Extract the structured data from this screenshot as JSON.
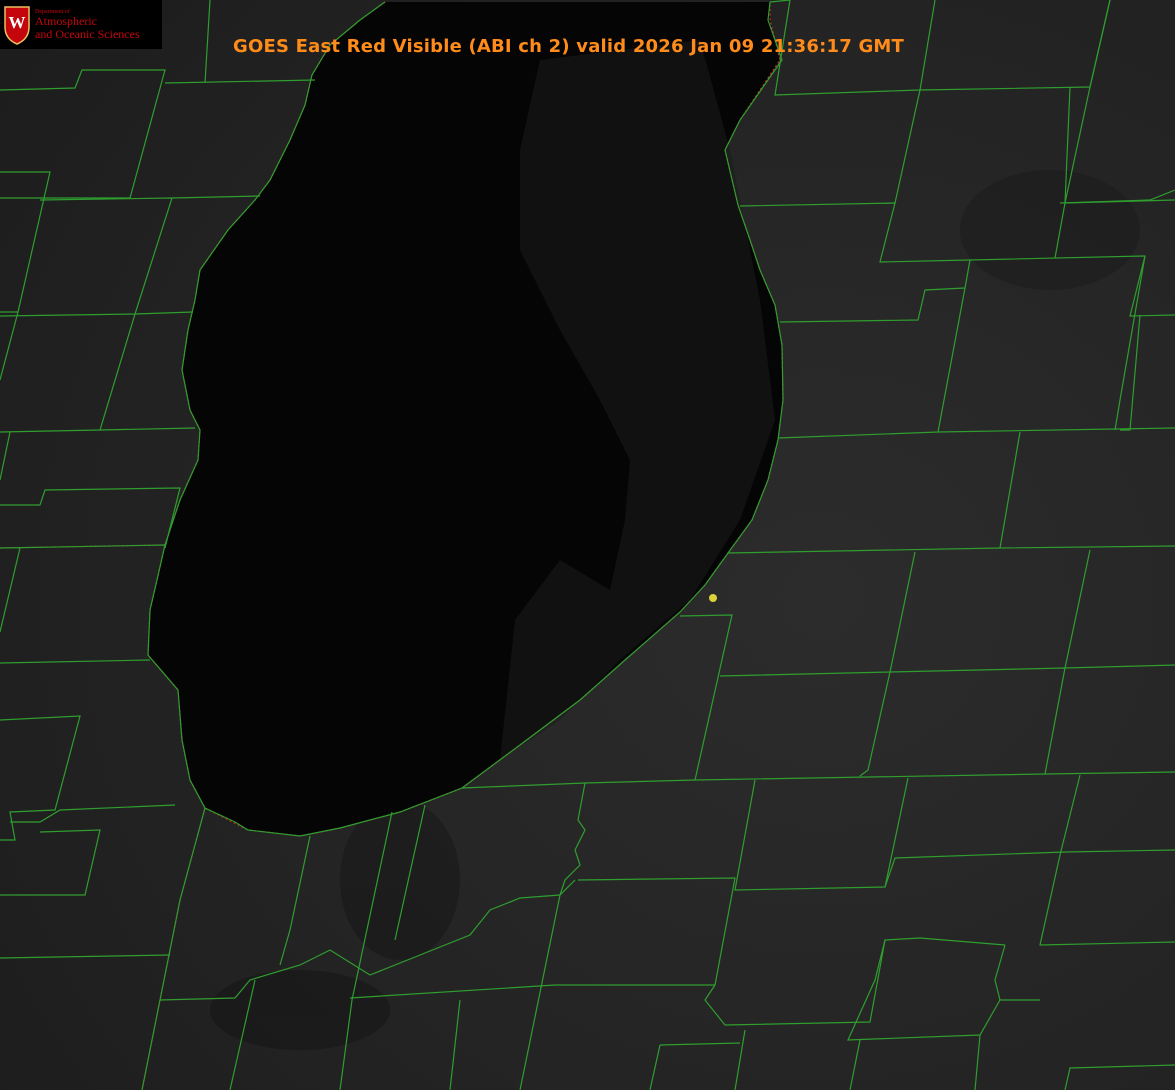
{
  "title": "GOES East Red Visible (ABI ch 2) valid 2026 Jan 09 21:36:17 GMT",
  "logo": {
    "initial": "W",
    "department": "Department of",
    "line1": "Atmospheric",
    "line2": "and Oceanic Sciences"
  },
  "colors": {
    "title": "#ff8c1a",
    "boundary": "#2f9e2f",
    "coastline_dotted": "#d22a2a",
    "marker": "#d9d23a",
    "logo_red": "#c5050c",
    "lake": "#050505",
    "land": "#262626"
  },
  "icons": [
    "uw-crest-icon",
    "location-marker-icon"
  ]
}
